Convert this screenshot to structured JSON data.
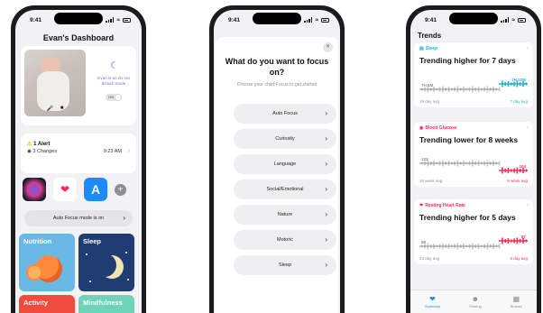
{
  "status_time": "9:41",
  "phone1": {
    "title": "Evan's Dashboard",
    "dnd_text": "Evan is on do not disturb mode",
    "toggle_label": "ON",
    "alert_title": "1 Alert",
    "alert_sub": "3 Changes",
    "alert_time": "9:23 AM",
    "auto_focus": "Auto Focus mode is on",
    "tiles": [
      "Nutrition",
      "Sleep",
      "Activity",
      "Mindfulness"
    ]
  },
  "phone2": {
    "title": "What do you want to focus on?",
    "subtitle": "Choose your child Focus to get started",
    "options": [
      "Auto Focus",
      "Curiosity",
      "Language",
      "Social/Emotional",
      "Nature",
      "Motoric",
      "Sleep"
    ]
  },
  "phone3": {
    "title": "Trends",
    "cards": [
      {
        "category": "Sleep",
        "headline": "Trending higher for 7 days",
        "left_value": "7H 6M",
        "right_value": "7H 32M",
        "left_legend": "19 day avg",
        "right_legend": "7 day avg",
        "accent": "#20b3c8"
      },
      {
        "category": "Blood Glucose",
        "headline": "Trending lower for 8 weeks",
        "left_value": "123",
        "right_value": "104",
        "left_legend": "16 week avg",
        "right_legend": "8 week avg",
        "accent": "#ff2d55"
      },
      {
        "category": "Resting Heart Rate",
        "headline": "Trending higher for 5 days",
        "left_value": "68",
        "right_value": "87",
        "left_legend": "23 day avg",
        "right_legend": "5 day avg",
        "accent": "#ff2d55"
      }
    ],
    "tabs": [
      "Summary",
      "Sharing",
      "Browse"
    ]
  },
  "colors": {
    "focus_purple": "#7b6ff0",
    "health_red": "#ff2d55",
    "sleep_teal": "#20b3c8",
    "tab_blue": "#1a8cff"
  }
}
